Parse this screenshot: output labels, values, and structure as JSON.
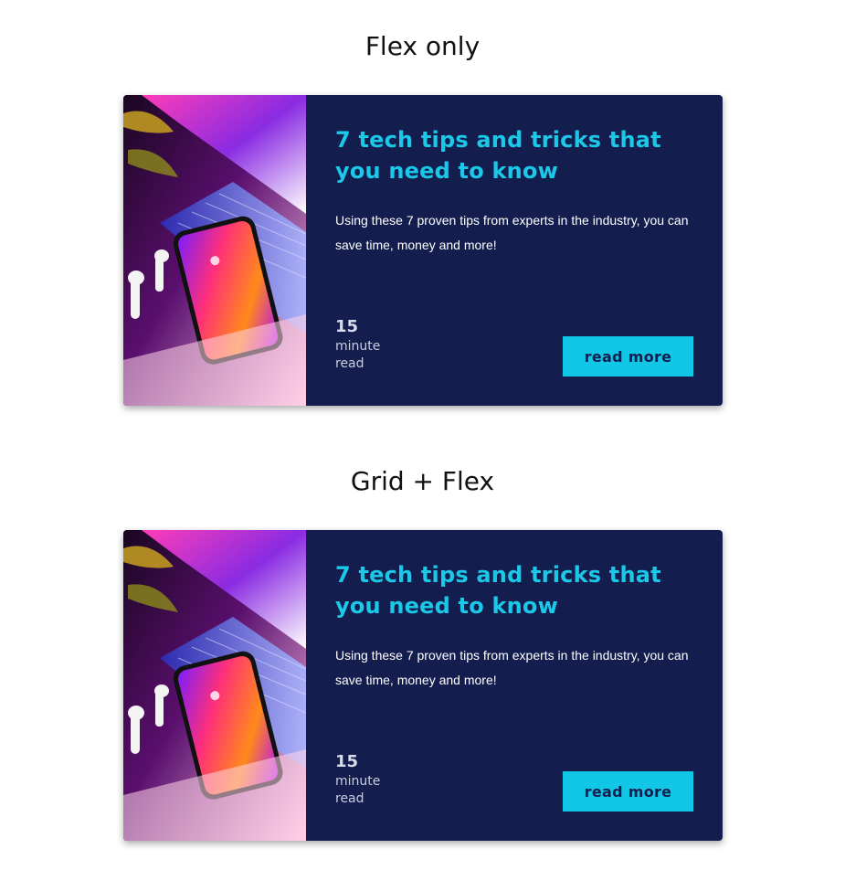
{
  "sections": [
    {
      "heading": "Flex only",
      "card": {
        "title": "7 tech tips and tricks that you need to know",
        "description": "Using these 7 proven tips from experts in the industry, you can save time, money and more!",
        "read_time": {
          "number": "15",
          "unit_line1": "minute",
          "unit_line2": "read"
        },
        "button_label": "read more"
      }
    },
    {
      "heading": "Grid + Flex",
      "card": {
        "title": "7 tech tips and tricks that you need to know",
        "description": "Using these 7 proven tips from experts in the industry, you can save time, money and more!",
        "read_time": {
          "number": "15",
          "unit_line1": "minute",
          "unit_line2": "read"
        },
        "button_label": "read more"
      }
    }
  ],
  "colors": {
    "card_background": "#131d4e",
    "accent": "#1cc8e8",
    "button_background": "#12c6e6",
    "text": "#ffffff"
  },
  "image": "laptop-and-phone-neon-photo"
}
